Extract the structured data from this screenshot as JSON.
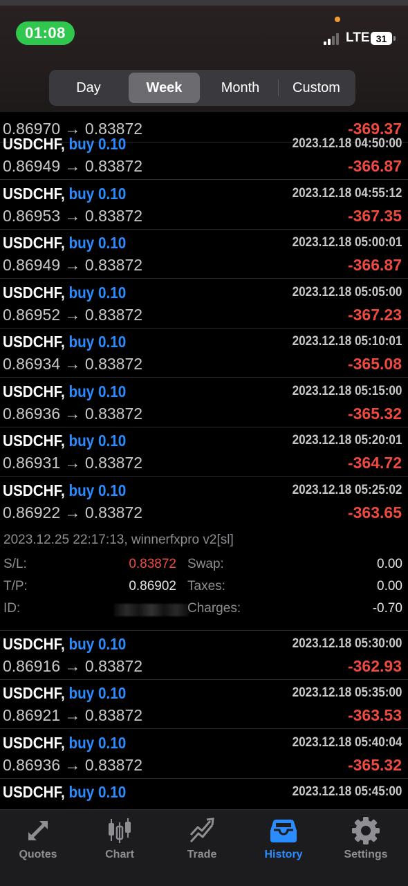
{
  "status_bar": {
    "time": "01:08",
    "network": "LTE",
    "battery": "31"
  },
  "period_tabs": [
    {
      "label": "Day",
      "active": false
    },
    {
      "label": "Week",
      "active": true
    },
    {
      "label": "Month",
      "active": false
    },
    {
      "label": "Custom",
      "active": false
    }
  ],
  "partial_top": {
    "prices": "0.86970 → 0.83872",
    "profit": "-369.37"
  },
  "trades_before": [
    {
      "symbol": "USDCHF,",
      "direction": "buy 0.10",
      "time": "2023.12.18 04:50:00",
      "prices": "0.86949 → 0.83872",
      "profit": "-366.87"
    },
    {
      "symbol": "USDCHF,",
      "direction": "buy 0.10",
      "time": "2023.12.18 04:55:12",
      "prices": "0.86953 → 0.83872",
      "profit": "-367.35"
    },
    {
      "symbol": "USDCHF,",
      "direction": "buy 0.10",
      "time": "2023.12.18 05:00:01",
      "prices": "0.86949 → 0.83872",
      "profit": "-366.87"
    },
    {
      "symbol": "USDCHF,",
      "direction": "buy 0.10",
      "time": "2023.12.18 05:05:00",
      "prices": "0.86952 → 0.83872",
      "profit": "-367.23"
    },
    {
      "symbol": "USDCHF,",
      "direction": "buy 0.10",
      "time": "2023.12.18 05:10:01",
      "prices": "0.86934 → 0.83872",
      "profit": "-365.08"
    },
    {
      "symbol": "USDCHF,",
      "direction": "buy 0.10",
      "time": "2023.12.18 05:15:00",
      "prices": "0.86936 → 0.83872",
      "profit": "-365.32"
    },
    {
      "symbol": "USDCHF,",
      "direction": "buy 0.10",
      "time": "2023.12.18 05:20:01",
      "prices": "0.86931 → 0.83872",
      "profit": "-364.72"
    },
    {
      "symbol": "USDCHF,",
      "direction": "buy 0.10",
      "time": "2023.12.18 05:25:02",
      "prices": "0.86922 → 0.83872",
      "profit": "-363.65"
    }
  ],
  "expanded_details": {
    "close_info": "2023.12.25 22:17:13, winnerfxpro v2[sl]",
    "sl_label": "S/L:",
    "sl_value": "0.83872",
    "tp_label": "T/P:",
    "tp_value": "0.86902",
    "id_label": "ID:",
    "swap_label": "Swap:",
    "swap_value": "0.00",
    "taxes_label": "Taxes:",
    "taxes_value": "0.00",
    "charges_label": "Charges:",
    "charges_value": "-0.70"
  },
  "trades_after": [
    {
      "symbol": "USDCHF,",
      "direction": "buy 0.10",
      "time": "2023.12.18 05:30:00",
      "prices": "0.86916 → 0.83872",
      "profit": "-362.93"
    },
    {
      "symbol": "USDCHF,",
      "direction": "buy 0.10",
      "time": "2023.12.18 05:35:00",
      "prices": "0.86921 → 0.83872",
      "profit": "-363.53"
    },
    {
      "symbol": "USDCHF,",
      "direction": "buy 0.10",
      "time": "2023.12.18 05:40:04",
      "prices": "0.86936 → 0.83872",
      "profit": "-365.32"
    },
    {
      "symbol": "USDCHF,",
      "direction": "buy 0.10",
      "time": "2023.12.18 05:45:00",
      "prices": "",
      "profit": ""
    }
  ],
  "tab_bar": [
    {
      "label": "Quotes",
      "icon": "quotes-icon",
      "active": false
    },
    {
      "label": "Chart",
      "icon": "chart-icon",
      "active": false
    },
    {
      "label": "Trade",
      "icon": "trade-icon",
      "active": false
    },
    {
      "label": "History",
      "icon": "history-icon",
      "active": true
    },
    {
      "label": "Settings",
      "icon": "settings-icon",
      "active": false
    }
  ],
  "colors": {
    "accent": "#2a8cff",
    "loss": "#ef4a40",
    "background": "#000000",
    "status_green": "#30c74f"
  }
}
